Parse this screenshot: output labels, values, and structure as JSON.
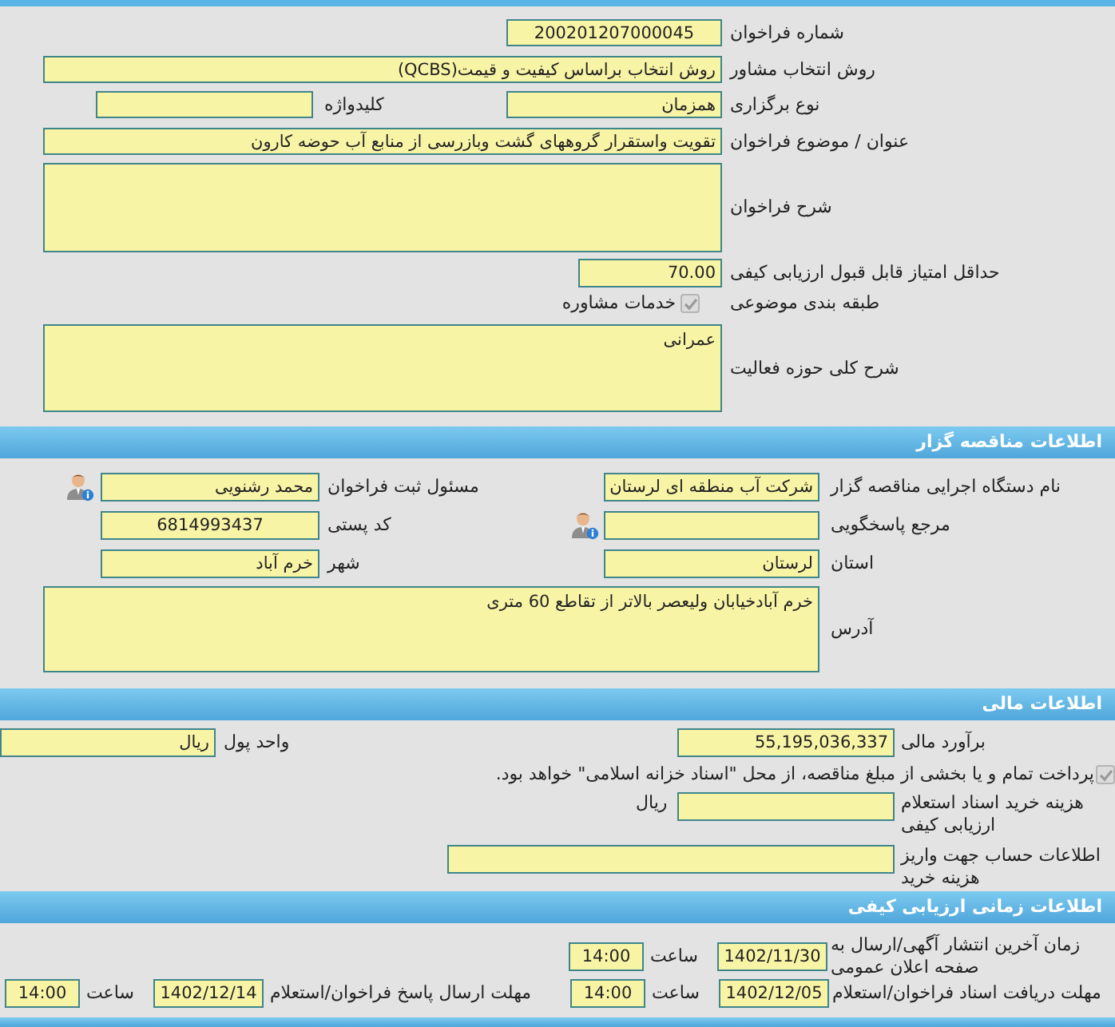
{
  "call": {
    "number": {
      "label": "شماره فراخوان",
      "value": "200201207000045"
    },
    "method": {
      "label": "روش انتخاب مشاور",
      "value": "روش انتخاب براساس کیفیت و قیمت(QCBS)"
    },
    "type": {
      "label": "نوع برگزاری",
      "value": "همزمان"
    },
    "keyword": {
      "label": "کلیدواژه"
    },
    "subject": {
      "label": "عنوان / موضوع فراخوان",
      "value": "تقویت واستقرار گروههای گشت وبازرسی از منابع آب حوضه کارون"
    },
    "description": {
      "label": "شرح فراخوان"
    },
    "min_score": {
      "label": "حداقل امتیاز قابل قبول ارزیابی کیفی",
      "value": "70.00"
    },
    "category": {
      "label": "طبقه بندی موضوعی",
      "option": "خدمات مشاوره",
      "checked": true,
      "disabled": true
    },
    "activity": {
      "label": "شرح کلی حوزه فعالیت",
      "value": "عمرانی"
    }
  },
  "tenderer": {
    "title": "اطلاعات مناقصه گزار",
    "organization": {
      "label": "نام دستگاه اجرایی مناقصه گزار",
      "value": "شرکت آب منطقه ای لرستان"
    },
    "registrar": {
      "label": "مسئول ثبت فراخوان",
      "value": "محمد رشنویی"
    },
    "contact": {
      "label": "مرجع پاسخگویی"
    },
    "postal_code": {
      "label": "کد پستی",
      "value": "6814993437"
    },
    "province": {
      "label": "استان",
      "value": "لرستان"
    },
    "city": {
      "label": "شهر",
      "value": "خرم آباد"
    },
    "address": {
      "label": "آدرس",
      "value": "خرم آبادخیابان ولیعصر بالاتر از تقاطع 60 متری"
    }
  },
  "financial": {
    "title": "اطلاعات مالی",
    "estimate": {
      "label": "برآورد مالی",
      "value": "55,195,036,337"
    },
    "currency": {
      "label": "واحد پول",
      "value": "ریال"
    },
    "treasury": {
      "text": "پرداخت تمام و یا بخشی از مبلغ مناقصه، از محل \"اسناد خزانه اسلامی\" خواهد بود.",
      "checked": true,
      "disabled": true
    },
    "document_fee": {
      "label": "هزینه خرید اسناد استعلام ارزیابی کیفی",
      "unit": "ریال"
    },
    "account_info": {
      "label": "اطلاعات حساب جهت واریز هزینه خرید"
    }
  },
  "schedule": {
    "title": "اطلاعات زمانی ارزیابی کیفی",
    "publish": {
      "label": "زمان آخرین انتشار آگهی/ارسال به صفحه اعلان عمومی",
      "date": "1402/11/30",
      "time_label": "ساعت",
      "time": "14:00"
    },
    "receive_deadline": {
      "label": "مهلت دریافت اسناد فراخوان/استعلام",
      "date": "1402/12/05",
      "time_label": "ساعت",
      "time": "14:00"
    },
    "response_deadline": {
      "label": "مهلت ارسال پاسخ فراخوان/استعلام",
      "date": "1402/12/14",
      "time_label": "ساعت",
      "time": "14:00"
    }
  }
}
